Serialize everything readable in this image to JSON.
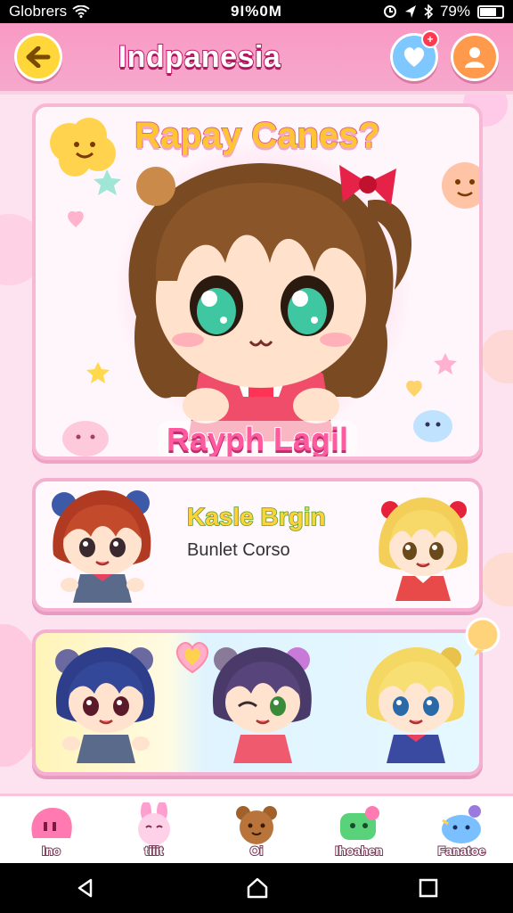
{
  "status_bar": {
    "carrier": "Globrers",
    "time": "9I%0M",
    "battery": "79%",
    "battery_level": 0.79
  },
  "header": {
    "title": "Indpanesia",
    "notification_badge": "+",
    "back_icon": "arrow-left-icon",
    "favorites_icon": "heart-icon",
    "profile_icon": "user-icon"
  },
  "hero": {
    "title": "Rapay Canes?",
    "character_name": "Rayph Lagil"
  },
  "list_card": {
    "title": "Kasle Brgin",
    "subtitle": "Bunlet Corso"
  },
  "bottom_nav": {
    "items": [
      {
        "label": "Ino",
        "icon": "pink-blob-icon"
      },
      {
        "label": "tiiit",
        "icon": "pink-bunny-icon"
      },
      {
        "label": "Oi",
        "icon": "brown-bear-icon"
      },
      {
        "label": "Ihoahen",
        "icon": "green-frog-icon"
      },
      {
        "label": "Fanatoe",
        "icon": "blue-bird-icon"
      }
    ]
  },
  "colors": {
    "header_pink": "#f89ac4",
    "back_yellow": "#ffd73a",
    "heart_blue": "#7ec8ff",
    "user_orange": "#ff9a4d",
    "card_border": "#f4b0d0"
  }
}
